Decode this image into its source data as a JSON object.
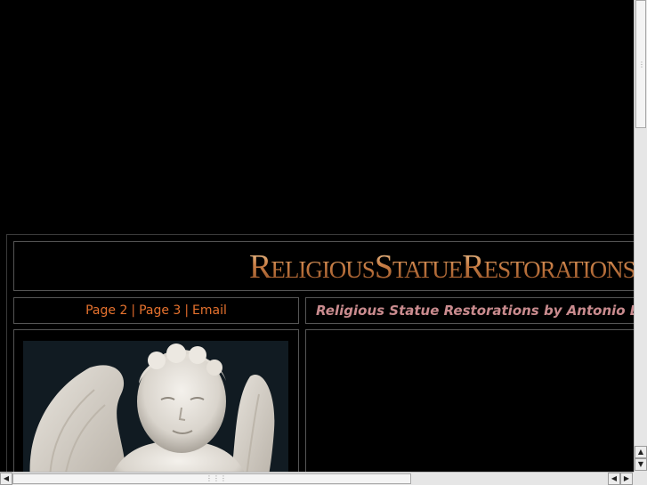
{
  "banner": {
    "title": "ReligiousStatueRestorations"
  },
  "nav": {
    "links": [
      "Page 2",
      "Page 3",
      "Email"
    ],
    "separator": "|"
  },
  "subtitle": "Religious Statue Restorations by Antonio Buffa",
  "images": {
    "statue": "angel-statue-photo"
  },
  "colors": {
    "background": "#000000",
    "link": "#e6722e",
    "subtitle": "#c98b8e",
    "border": "#555555"
  }
}
